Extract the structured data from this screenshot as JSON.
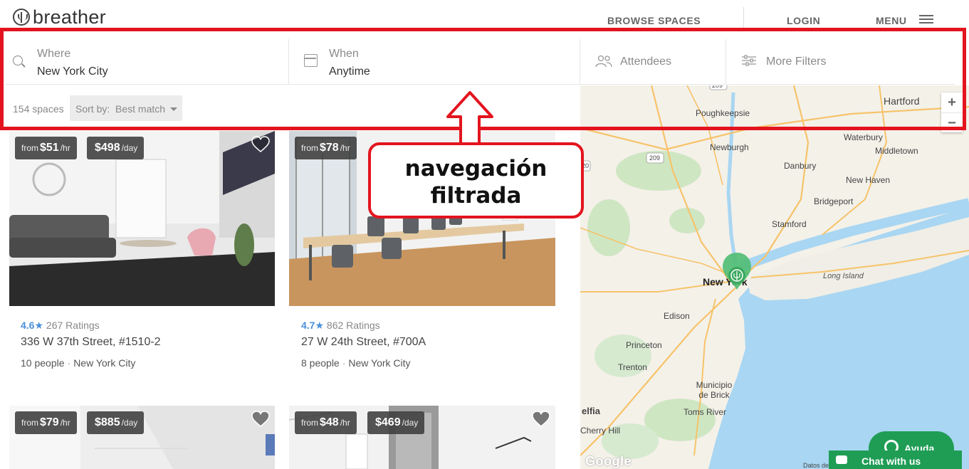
{
  "header": {
    "brand": "breather",
    "nav": {
      "browse": "BROWSE SPACES",
      "login": "LOGIN",
      "menu": "MENU"
    }
  },
  "filters": {
    "where": {
      "label": "Where",
      "value": "New York City"
    },
    "when": {
      "label": "When",
      "value": "Anytime"
    },
    "attendees": {
      "label": "Attendees"
    },
    "more": {
      "label": "More Filters"
    }
  },
  "results": {
    "count": "154 spaces",
    "sort_label": "Sort by:",
    "sort_value": "Best match"
  },
  "listings": [
    {
      "from": "from",
      "hourly": "$51",
      "hourly_unit": "/hr",
      "daily": "$498",
      "daily_unit": "/day",
      "rating": "4.6",
      "ratings_count": "267 Ratings",
      "address": "336 W 37th Street, #1510-2",
      "people": "10 people",
      "city": "New York City"
    },
    {
      "from": "from",
      "hourly": "$78",
      "hourly_unit": "/hr",
      "rating": "4.7",
      "ratings_count": "862 Ratings",
      "address": "27 W 24th Street, #700A",
      "people": "8 people",
      "city": "New York City"
    },
    {
      "from": "from",
      "hourly": "$79",
      "hourly_unit": "/hr",
      "daily": "$885",
      "daily_unit": "/day"
    },
    {
      "from": "from",
      "hourly": "$48",
      "hourly_unit": "/hr",
      "daily": "$469",
      "daily_unit": "/day"
    }
  ],
  "map": {
    "labels": {
      "hartford": "Hartford",
      "poughkeepsie": "Poughkeepsie",
      "waterbury": "Waterbury",
      "middletown": "Middletown",
      "newburgh": "Newburgh",
      "danbury": "Danbury",
      "newhaven": "New Haven",
      "bridgeport": "Bridgeport",
      "stamford": "Stamford",
      "longisland": "Long Island",
      "newyork": "New York",
      "edison": "Edison",
      "princeton": "Princeton",
      "trenton": "Trenton",
      "municipio": "Municipio de Brick",
      "tomsriver": "Toms River",
      "delfia": "elfia",
      "cherryhill": "Cherry Hill"
    },
    "road_shields": {
      "r209a": "209",
      "r209b": "209",
      "r209c": "209"
    },
    "zoom_in": "+",
    "zoom_out": "−",
    "google": "Google",
    "terms": "Datos de"
  },
  "annotation": {
    "line1": "navegación",
    "line2": "filtrada"
  },
  "widgets": {
    "ayuda": "Ayuda",
    "chat": "Chat with us"
  },
  "colors": {
    "annotation": "#e3141e",
    "accent": "#4a90d9",
    "chat": "#1f9d55",
    "pin": "#4fbd73"
  }
}
